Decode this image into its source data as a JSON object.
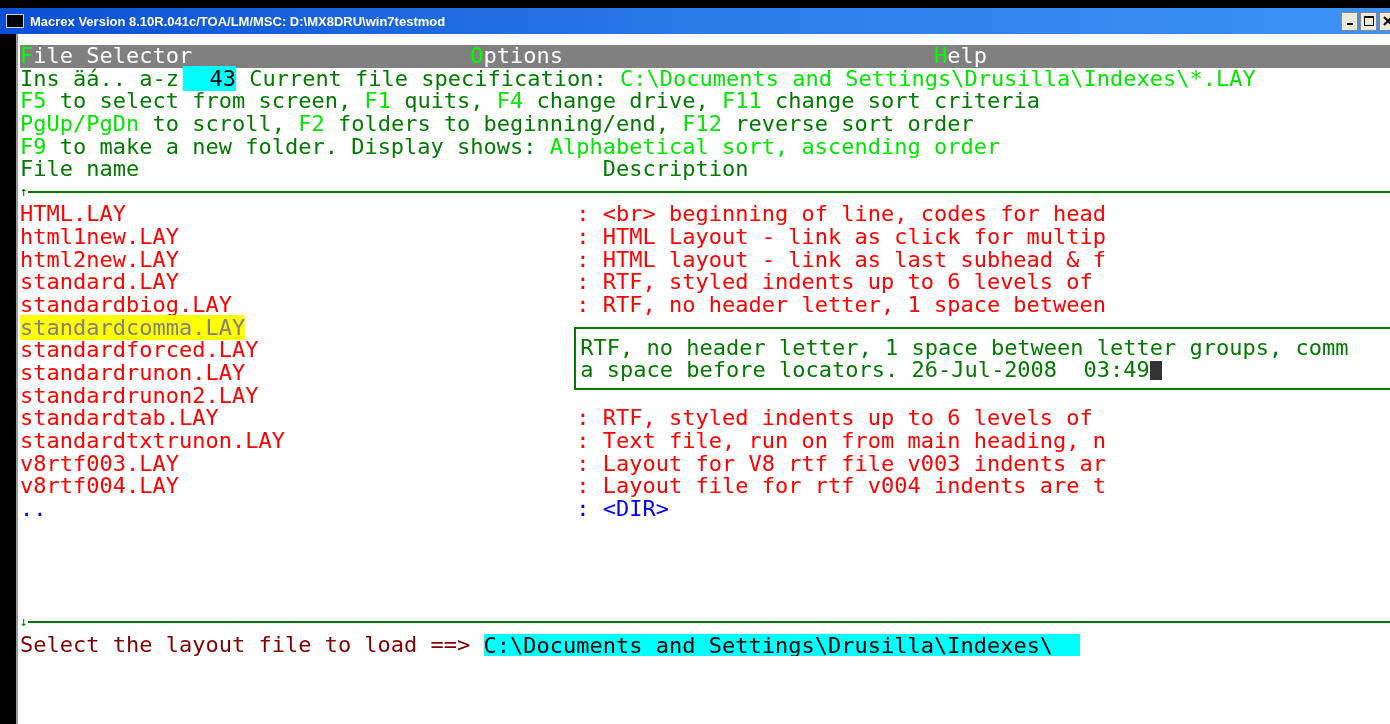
{
  "window": {
    "title": "Macrex Version 8.10R.041c/TOA/LM/MSC: D:\\MX8DRU\\win7testmod"
  },
  "menu": [
    {
      "label": "File Selector"
    },
    {
      "label": "Options"
    },
    {
      "label": "Help"
    }
  ],
  "info_lines": [
    [
      {
        "text": "Ins äá.. a-z",
        "kind": "plain"
      },
      {
        "text": "43",
        "kind": "counter"
      },
      {
        "text": " Current file specification: ",
        "kind": "plain"
      },
      {
        "text": "C:\\Documents and Settings\\Drusilla\\Indexes\\*.LAY",
        "kind": "key"
      }
    ],
    [
      {
        "text": "F5",
        "kind": "key"
      },
      {
        "text": " to select from screen, ",
        "kind": "plain"
      },
      {
        "text": "F1",
        "kind": "key"
      },
      {
        "text": " quits, ",
        "kind": "plain"
      },
      {
        "text": "F4",
        "kind": "key"
      },
      {
        "text": " change drive, ",
        "kind": "plain"
      },
      {
        "text": "F11",
        "kind": "key"
      },
      {
        "text": " change sort criteria",
        "kind": "plain"
      }
    ],
    [
      {
        "text": "PgUp/PgDn",
        "kind": "key"
      },
      {
        "text": " to scroll, ",
        "kind": "plain"
      },
      {
        "text": "F2",
        "kind": "key"
      },
      {
        "text": " folders to beginning/end, ",
        "kind": "plain"
      },
      {
        "text": "F12",
        "kind": "key"
      },
      {
        "text": " reverse sort order",
        "kind": "plain"
      }
    ],
    [
      {
        "text": "F9",
        "kind": "key"
      },
      {
        "text": " to make a new folder. Display shows: ",
        "kind": "plain"
      },
      {
        "text": "Alphabetical sort, ascending order",
        "kind": "key"
      }
    ]
  ],
  "columns": {
    "file_name": "File name",
    "description": "Description"
  },
  "scroll_up": "↑",
  "scroll_down": "↓",
  "files": [
    {
      "name": "HTML.LAY",
      "description": ": <br> beginning of line, codes for head",
      "kind": "file",
      "selected": false
    },
    {
      "name": "html1new.LAY",
      "description": ": HTML Layout - link as click for multip",
      "kind": "file",
      "selected": false
    },
    {
      "name": "html2new.LAY",
      "description": ": HTML layout - link as last subhead & f",
      "kind": "file",
      "selected": false
    },
    {
      "name": "standard.LAY",
      "description": ": RTF, styled indents up to 6 levels of",
      "kind": "file",
      "selected": false
    },
    {
      "name": "standardbiog.LAY",
      "description": ": RTF, no header letter, 1 space between",
      "kind": "file",
      "selected": false
    },
    {
      "name": "standardcomma.LAY",
      "kind": "file",
      "selected": true
    },
    {
      "name": "standardforced.LAY",
      "kind": "file",
      "selected": false
    },
    {
      "name": "standardrunon.LAY",
      "kind": "file",
      "selected": false
    },
    {
      "name": "standardrunon2.LAY",
      "kind": "file",
      "selected": false
    },
    {
      "name": "standardtab.LAY",
      "description": ": RTF, styled indents up to 6 levels of",
      "kind": "file",
      "selected": false
    },
    {
      "name": "standardtxtrunon.LAY",
      "description": ": Text file, run on from main heading, n",
      "kind": "file",
      "selected": false
    },
    {
      "name": "v8rtf003.LAY",
      "description": ": Layout for V8 rtf file v003 indents ar",
      "kind": "file",
      "selected": false
    },
    {
      "name": "v8rtf004.LAY",
      "description": ": Layout file for rtf v004 indents are t",
      "kind": "file",
      "selected": false
    },
    {
      "name": "..",
      "description": ": <DIR>",
      "kind": "dir",
      "selected": false
    }
  ],
  "detail_box": {
    "lines": [
      "RTF, no header letter, 1 space between letter groups, comm",
      "a space before locators. 26-Jul-2008  03:49"
    ]
  },
  "prompt": {
    "label": "Select the layout file to load ==>",
    "value": "C:\\Documents and Settings\\Drusilla\\Indexes\\"
  }
}
